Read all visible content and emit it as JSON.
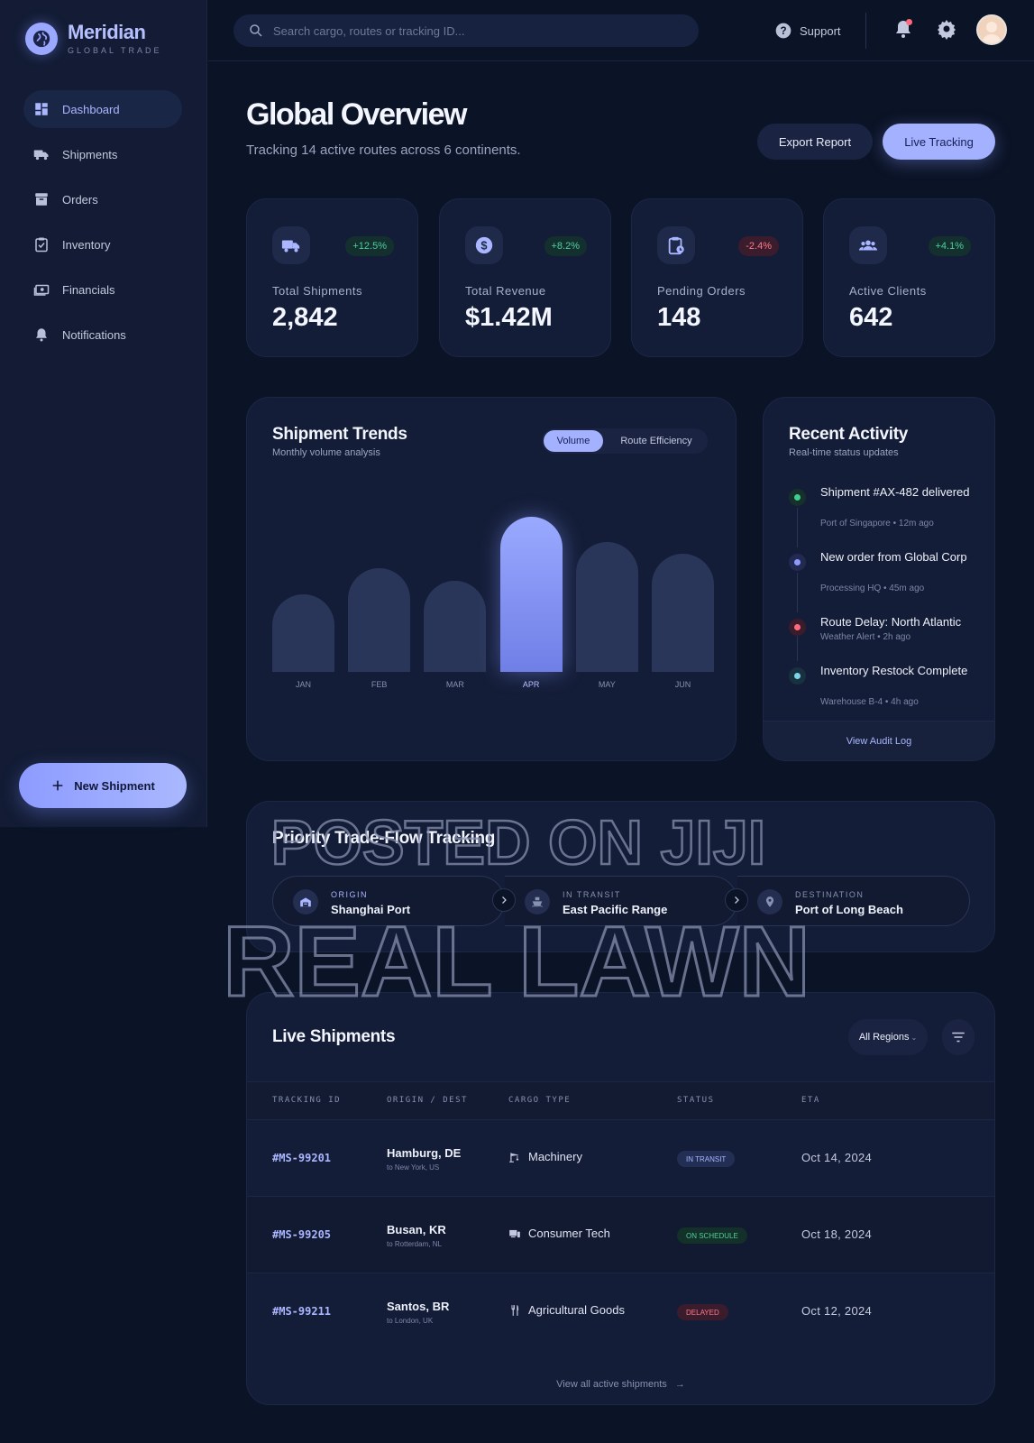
{
  "brand": {
    "name": "Meridian",
    "tagline": "GLOBAL TRADE"
  },
  "nav": {
    "items": [
      {
        "label": "Dashboard",
        "icon": "dashboard-icon",
        "active": true
      },
      {
        "label": "Shipments",
        "icon": "truck-icon"
      },
      {
        "label": "Orders",
        "icon": "archive-icon"
      },
      {
        "label": "Inventory",
        "icon": "clipboard-check-icon"
      },
      {
        "label": "Financials",
        "icon": "cash-icon"
      },
      {
        "label": "Notifications",
        "icon": "bell-icon"
      }
    ],
    "new_shipment": "New Shipment"
  },
  "topbar": {
    "search_placeholder": "Search cargo, routes or tracking ID...",
    "support": "Support"
  },
  "header": {
    "title": "Global Overview",
    "subtitle": "Tracking 14 active routes across 6 continents.",
    "export_label": "Export Report",
    "live_label": "Live Tracking"
  },
  "stats": [
    {
      "label": "Total Shipments",
      "value": "2,842",
      "change": "+12.5%",
      "trend": "up",
      "icon": "truck-icon"
    },
    {
      "label": "Total Revenue",
      "value": "$1.42M",
      "change": "+8.2%",
      "trend": "up",
      "icon": "dollar-icon"
    },
    {
      "label": "Pending Orders",
      "value": "148",
      "change": "-2.4%",
      "trend": "down",
      "icon": "pending-clipboard-icon"
    },
    {
      "label": "Active Clients",
      "value": "642",
      "change": "+4.1%",
      "trend": "up",
      "icon": "group-icon"
    }
  ],
  "trends": {
    "title": "Shipment Trends",
    "subtitle": "Monthly volume analysis",
    "toggle_on": "Volume",
    "toggle_off": "Route Efficiency"
  },
  "chart_data": {
    "type": "bar",
    "categories": [
      "JAN",
      "FEB",
      "MAR",
      "APR",
      "MAY",
      "JUN"
    ],
    "values": [
      50,
      67,
      59,
      100,
      84,
      76
    ],
    "highlight": "APR",
    "ylim": [
      0,
      100
    ],
    "grid": false
  },
  "activity": {
    "title": "Recent Activity",
    "subtitle": "Real-time status updates",
    "items": [
      {
        "title": "Shipment #AX-482 delivered",
        "meta": "Port of Singapore • 12m ago",
        "color": "#3ecf8e"
      },
      {
        "title": "New order from Global Corp",
        "meta": "Processing HQ • 45m ago",
        "color": "#8d9bff"
      },
      {
        "title": "Route Delay: North Atlantic",
        "meta": "Weather Alert • 2h ago",
        "color": "#ff6b7d"
      },
      {
        "title": "Inventory Restock Complete",
        "meta": "Warehouse B-4 • 4h ago",
        "color": "#7fd3e6"
      }
    ],
    "audit_label": "View Audit Log"
  },
  "flow": {
    "title": "Priority Trade-Flow Tracking",
    "steps": [
      {
        "label": "ORIGIN",
        "value": "Shanghai Port",
        "icon": "warehouse-icon"
      },
      {
        "label": "IN TRANSIT",
        "value": "East Pacific Range",
        "icon": "ship-icon"
      },
      {
        "label": "DESTINATION",
        "value": "Port of Long Beach",
        "icon": "location-pin-icon"
      }
    ]
  },
  "shipments": {
    "title": "Live Shipments",
    "region_filter": "All Regions",
    "columns": [
      "TRACKING ID",
      "ORIGIN / DEST",
      "CARGO TYPE",
      "STATUS",
      "ETA"
    ],
    "rows": [
      {
        "id": "#MS-99201",
        "origin": "Hamburg, DE",
        "dest": "to New York, US",
        "cargo": "Machinery",
        "cargo_icon": "crane-icon",
        "status": "IN TRANSIT",
        "status_kind": "transit",
        "eta": "Oct 14, 2024"
      },
      {
        "id": "#MS-99205",
        "origin": "Busan, KR",
        "dest": "to Rotterdam, NL",
        "cargo": "Consumer Tech",
        "cargo_icon": "devices-icon",
        "status": "ON SCHEDULE",
        "status_kind": "sched",
        "eta": "Oct 18, 2024"
      },
      {
        "id": "#MS-99211",
        "origin": "Santos, BR",
        "dest": "to London, UK",
        "cargo": "Agricultural Goods",
        "cargo_icon": "fork-knife-icon",
        "status": "DELAYED",
        "status_kind": "delay",
        "eta": "Oct 12, 2024"
      }
    ],
    "view_all": "View all active shipments"
  },
  "watermark": {
    "line1": "POSTED ON JIJI",
    "line2": "REAL LAWN"
  }
}
